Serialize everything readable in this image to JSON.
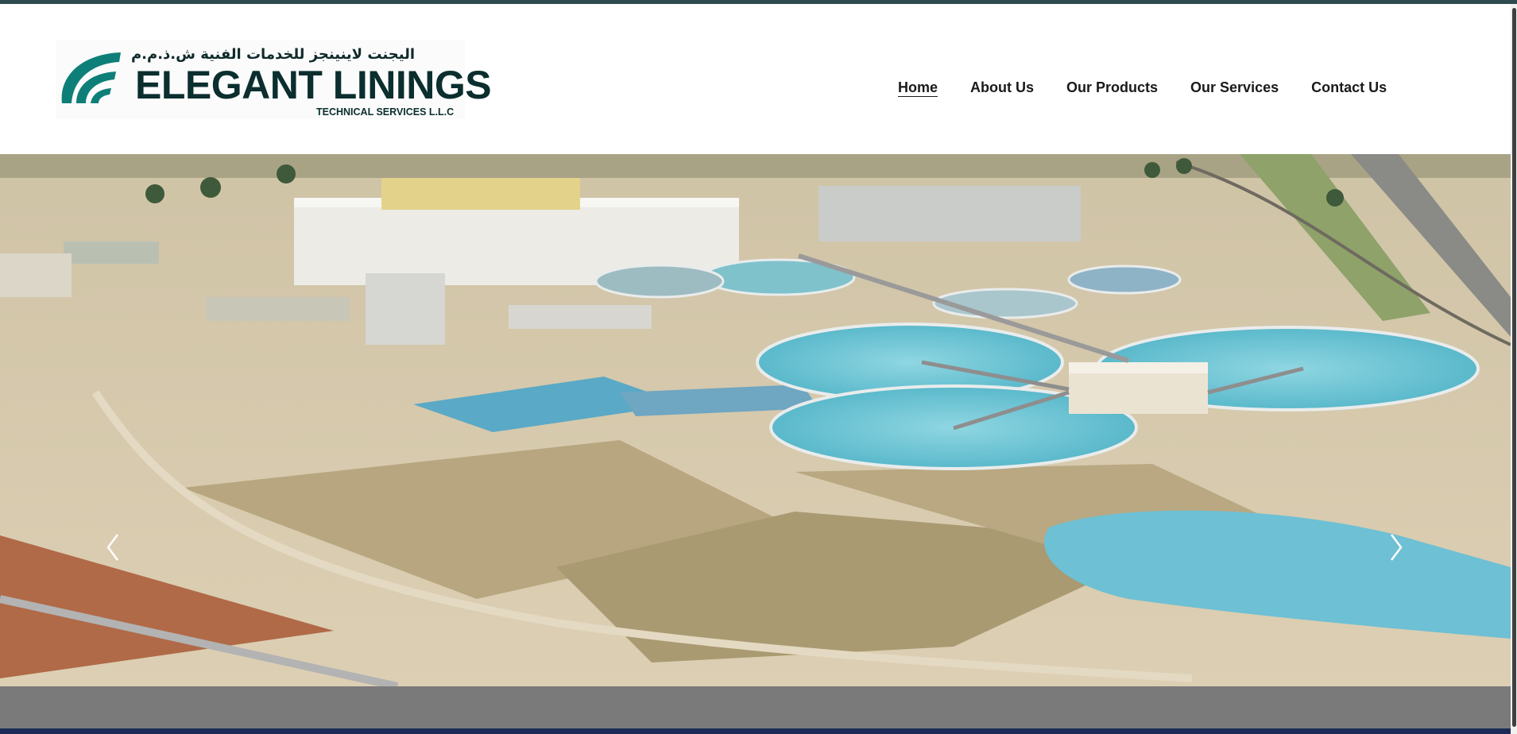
{
  "logo": {
    "arabic": "اليجنت لاينينجز للخدمات الفنية ش.ذ.م.م",
    "name": "ELEGANT LININGS",
    "tagline": "TECHNICAL SERVICES L.L.C",
    "brand_color": "#0e7f78"
  },
  "nav": {
    "items": [
      {
        "label": "Home",
        "active": true
      },
      {
        "label": "About Us",
        "active": false
      },
      {
        "label": "Our Products",
        "active": false
      },
      {
        "label": "Our Services",
        "active": false
      },
      {
        "label": "Contact Us",
        "active": false
      }
    ]
  },
  "hero": {
    "image_subject": "aerial-view-water-treatment-plant",
    "prev_icon": "chevron-left-icon",
    "next_icon": "chevron-right-icon"
  },
  "colors": {
    "top_strip": "#2f4a4f",
    "footer_band": "#7a7a7a",
    "water": "#6fc6d6",
    "ground": "#d8c8aa"
  }
}
